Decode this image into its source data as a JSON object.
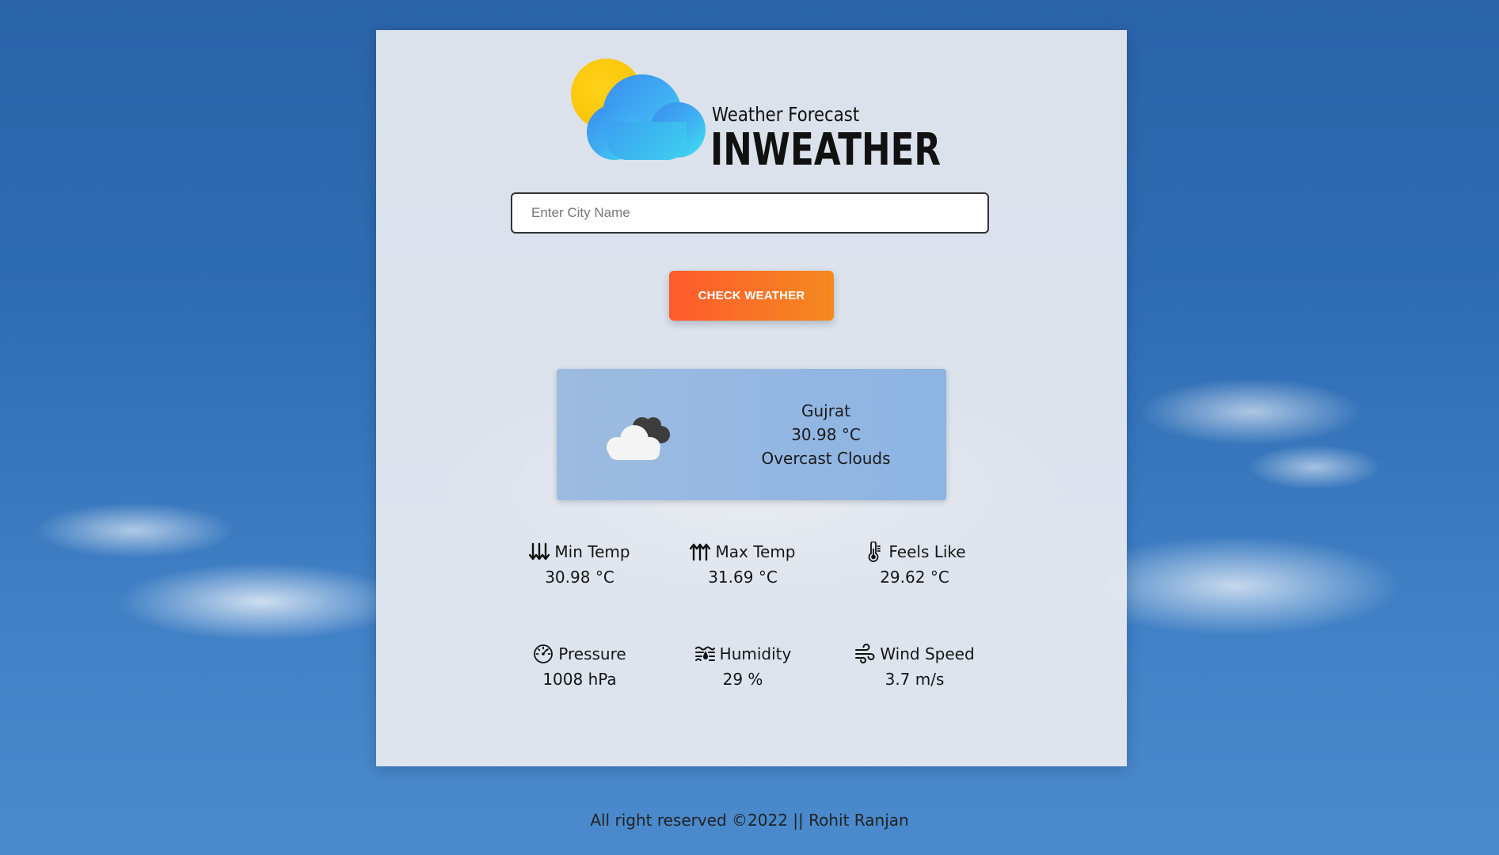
{
  "app": {
    "tagline": "Weather Forecast",
    "brand": "INWEATHER"
  },
  "search": {
    "placeholder": "Enter City Name",
    "value": ""
  },
  "actions": {
    "check_label": "CHECK WEATHER"
  },
  "result": {
    "city": "Gujrat",
    "temperature": "30.98 °C",
    "description": "Overcast Clouds",
    "icon": "overcast-clouds-icon"
  },
  "stats": {
    "min_temp": {
      "label": "Min Temp",
      "value": "30.98 °C",
      "icon": "arrows-down-icon"
    },
    "max_temp": {
      "label": "Max Temp",
      "value": "31.69 °C",
      "icon": "arrows-up-icon"
    },
    "feels_like": {
      "label": "Feels Like",
      "value": "29.62 °C",
      "icon": "thermometer-icon"
    },
    "pressure": {
      "label": "Pressure",
      "value": "1008 hPa",
      "icon": "gauge-icon"
    },
    "humidity": {
      "label": "Humidity",
      "value": "29 %",
      "icon": "humidity-icon"
    },
    "wind_speed": {
      "label": "Wind Speed",
      "value": "3.7 m/s",
      "icon": "wind-icon"
    }
  },
  "footer": {
    "text": "All right reserved ©2022 || Rohit Ranjan"
  },
  "colors": {
    "accent_start": "#ff5a2e",
    "accent_end": "#f48a20",
    "result_bg": "#8db4e3"
  }
}
